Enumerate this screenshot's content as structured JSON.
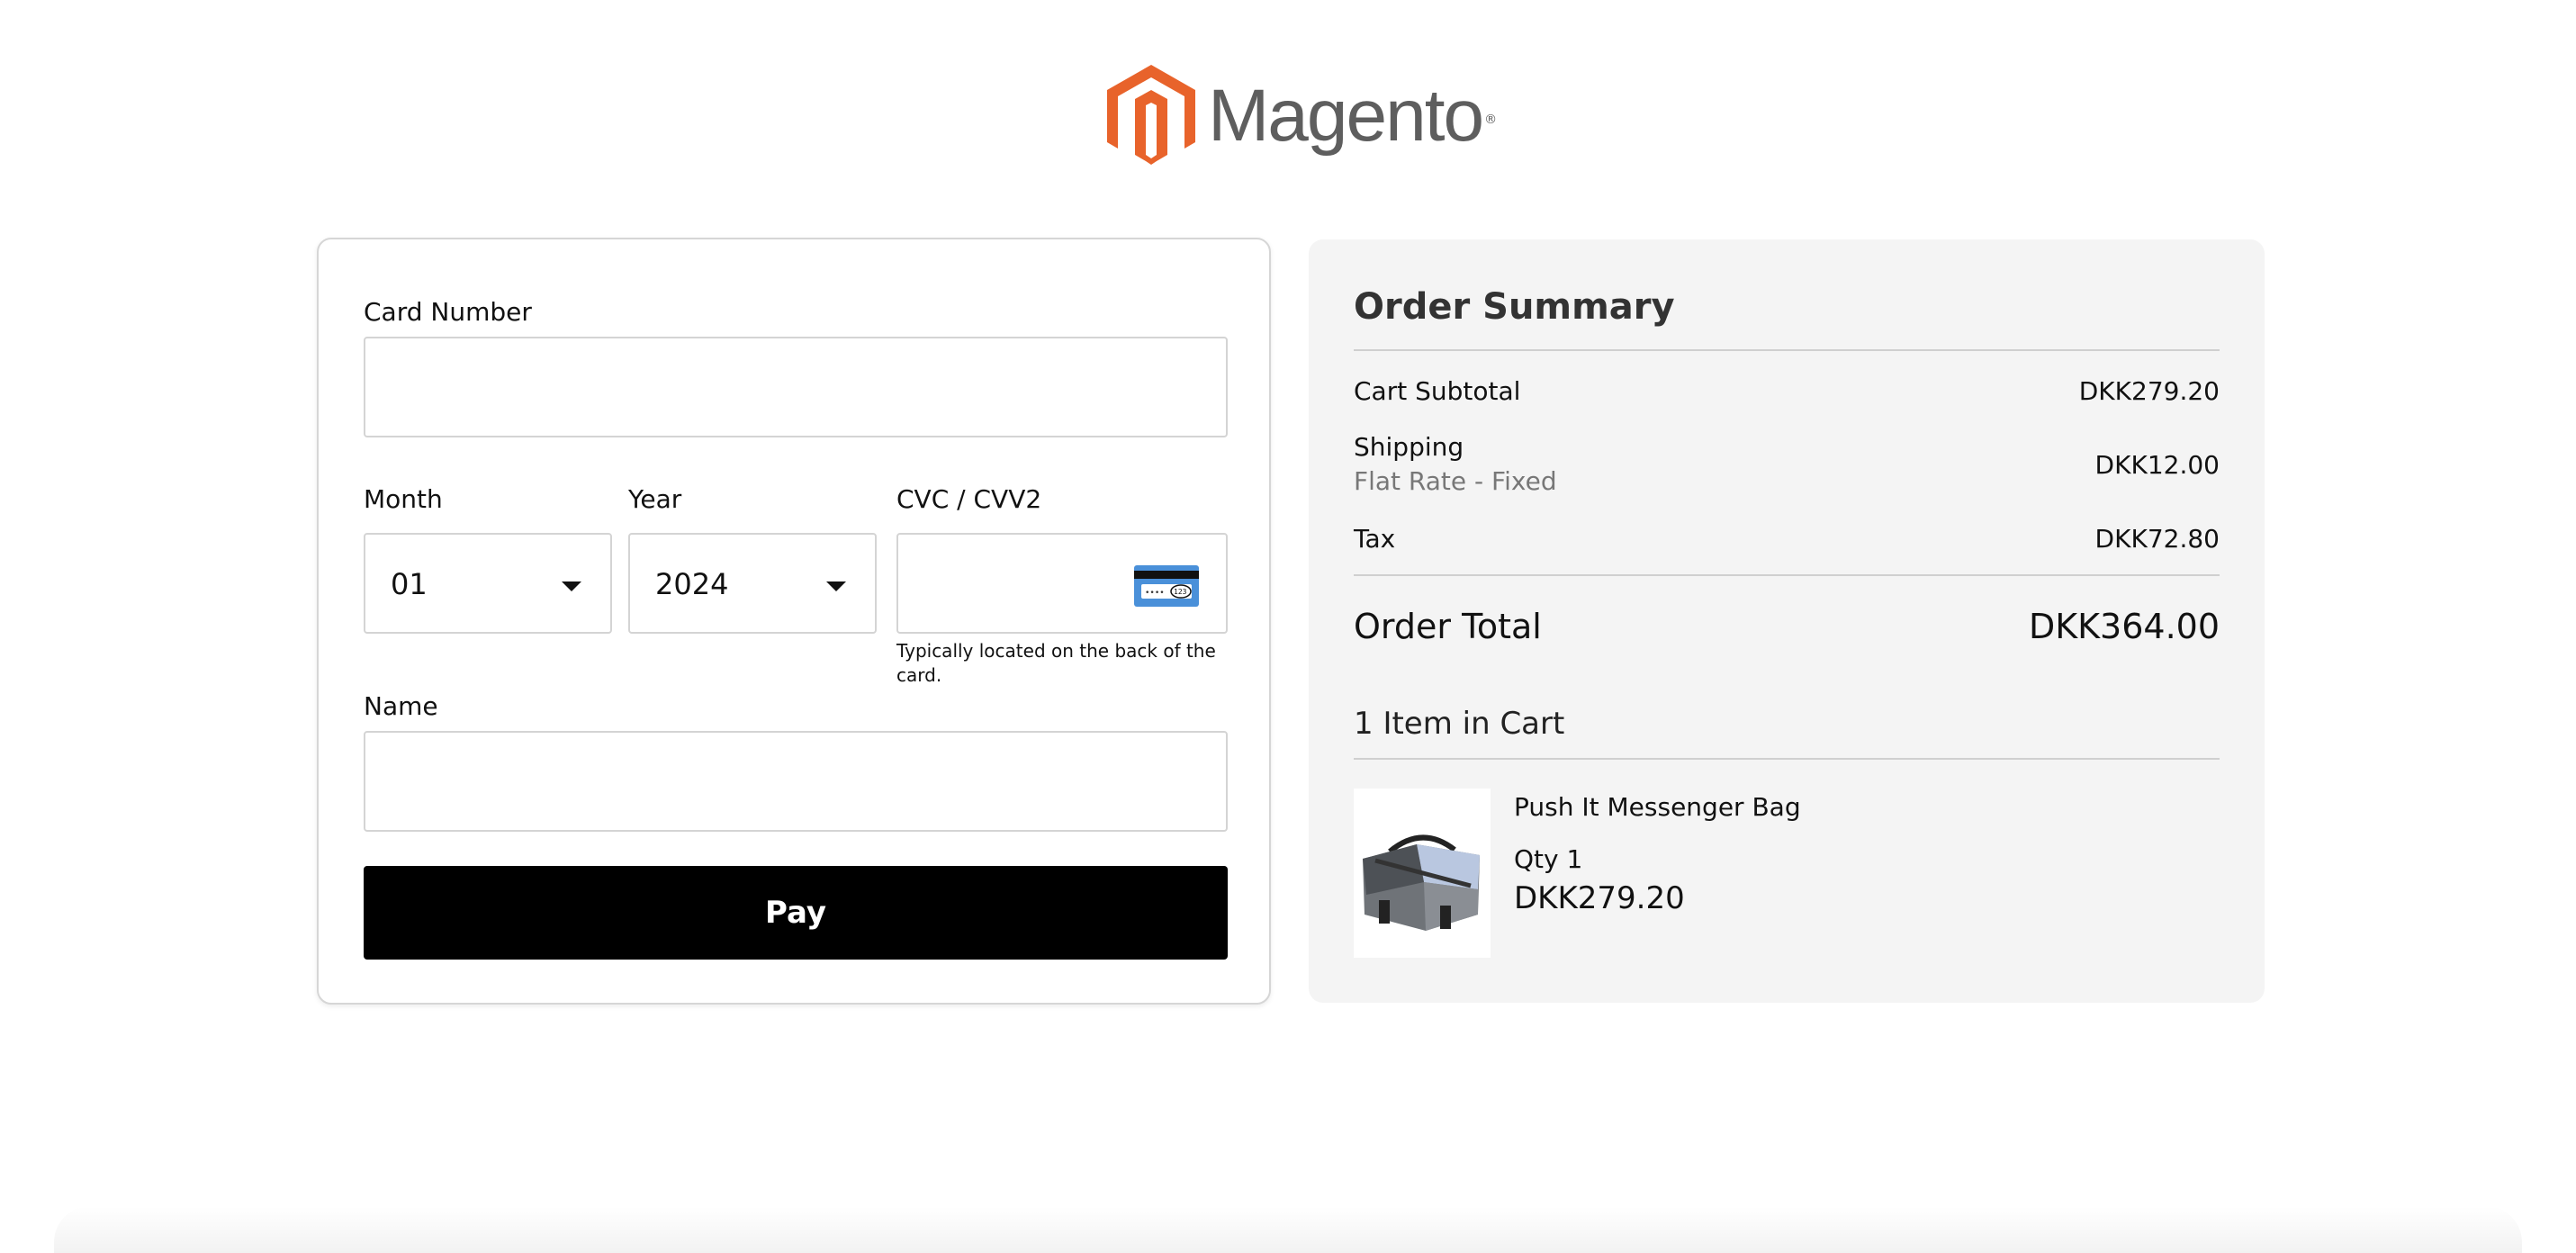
{
  "logo": {
    "wordmark": "Magento",
    "registered": "®",
    "brand_color": "#e8632b"
  },
  "payment_form": {
    "card_number": {
      "label": "Card Number",
      "value": "",
      "placeholder": ""
    },
    "month": {
      "label": "Month",
      "selected": "01"
    },
    "year": {
      "label": "Year",
      "selected": "2024"
    },
    "cvc": {
      "label": "CVC / CVV2",
      "value": "",
      "hint": "Typically located on the back of the card.",
      "icon": "card-back-cvc-icon"
    },
    "name": {
      "label": "Name",
      "value": ""
    },
    "pay_label": "Pay"
  },
  "order_summary": {
    "title": "Order Summary",
    "rows": [
      {
        "label": "Cart Subtotal",
        "value": "DKK279.20"
      },
      {
        "label": "Shipping",
        "sublabel": "Flat Rate - Fixed",
        "value": "DKK12.00"
      },
      {
        "label": "Tax",
        "value": "DKK72.80"
      }
    ],
    "total_label": "Order Total",
    "total_value": "DKK364.00",
    "items_count": "1 Item in Cart",
    "items": [
      {
        "name": "Push It Messenger Bag",
        "qty": "Qty 1",
        "price": "DKK279.20",
        "image": "messenger-bag-image"
      }
    ]
  },
  "colors": {
    "pay_button_bg": "#000000",
    "summary_bg": "#f4f4f4",
    "cvc_icon_blue": "#4a90d9"
  }
}
